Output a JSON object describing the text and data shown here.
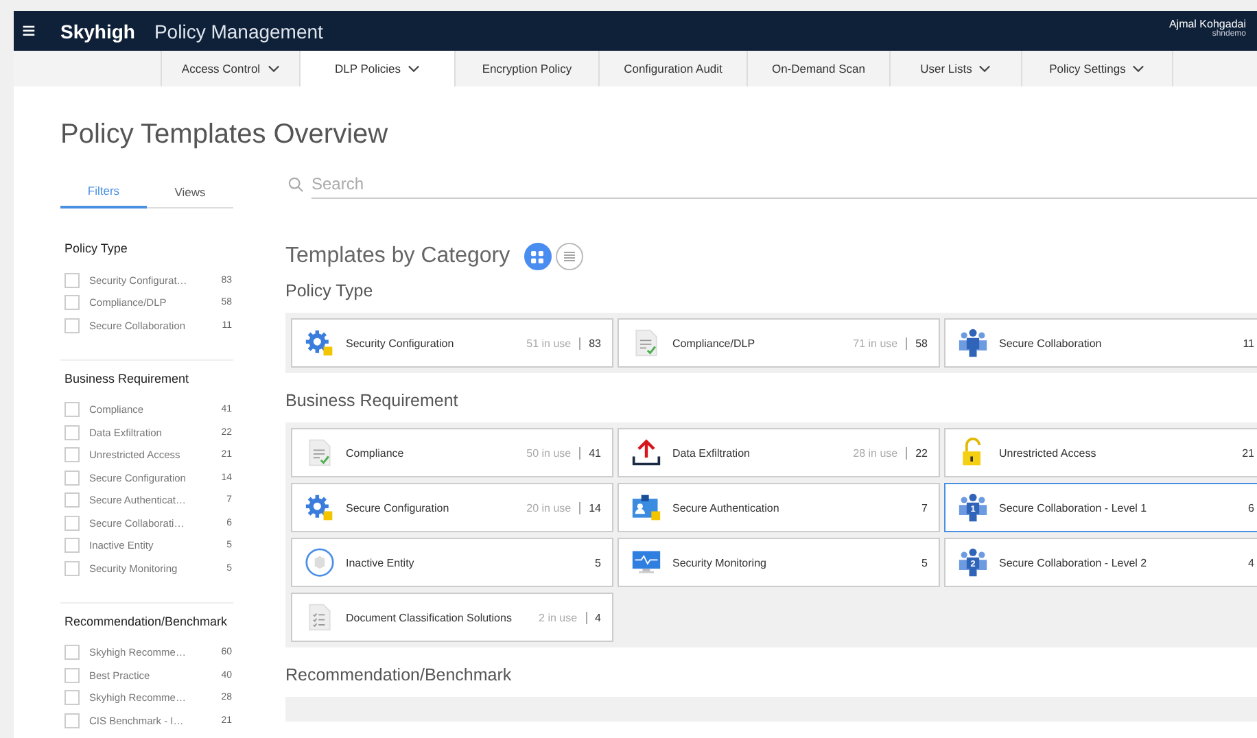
{
  "header": {
    "menu_icon": "≡",
    "brand": "Skyhigh",
    "app_title": "Policy Management",
    "user_name": "Ajmal Kohgadai",
    "tenant": "shndemo"
  },
  "nav_tabs": [
    {
      "label": "Access Control",
      "dropdown": true,
      "selected": false
    },
    {
      "label": "DLP Policies",
      "dropdown": true,
      "selected": true
    },
    {
      "label": "Encryption Policy",
      "dropdown": false,
      "selected": false
    },
    {
      "label": "Configuration Audit",
      "dropdown": false,
      "selected": false
    },
    {
      "label": "On-Demand Scan",
      "dropdown": false,
      "selected": false
    },
    {
      "label": "User Lists",
      "dropdown": true,
      "selected": false
    },
    {
      "label": "Policy Settings",
      "dropdown": true,
      "selected": false
    }
  ],
  "page_title": "Policy Templates Overview",
  "sidebar": {
    "tabs": [
      {
        "label": "Filters",
        "selected": true
      },
      {
        "label": "Views",
        "selected": false
      }
    ],
    "sections": [
      {
        "title": "Policy Type",
        "items": [
          {
            "label": "Security Configurat…",
            "count": "83",
            "checked": false
          },
          {
            "label": "Compliance/DLP",
            "count": "58",
            "checked": false
          },
          {
            "label": "Secure Collaboration",
            "count": "11",
            "checked": false
          }
        ]
      },
      {
        "title": "Business Requirement",
        "items": [
          {
            "label": "Compliance",
            "count": "41",
            "checked": false
          },
          {
            "label": "Data Exfiltration",
            "count": "22",
            "checked": false
          },
          {
            "label": "Unrestricted Access",
            "count": "21",
            "checked": false
          },
          {
            "label": "Secure Configuration",
            "count": "14",
            "checked": false
          },
          {
            "label": "Secure Authenticat…",
            "count": "7",
            "checked": false
          },
          {
            "label": "Secure Collaborati…",
            "count": "6",
            "checked": false
          },
          {
            "label": "Inactive Entity",
            "count": "5",
            "checked": false
          },
          {
            "label": "Security Monitoring",
            "count": "5",
            "checked": false
          }
        ]
      },
      {
        "title": "Recommendation/Benchmark",
        "items": [
          {
            "label": "Skyhigh Recomme…",
            "count": "60",
            "checked": false
          },
          {
            "label": "Best Practice",
            "count": "40",
            "checked": false
          },
          {
            "label": "Skyhigh Recomme…",
            "count": "28",
            "checked": false
          },
          {
            "label": "CIS Benchmark - I…",
            "count": "21",
            "checked": false
          }
        ]
      }
    ]
  },
  "search": {
    "placeholder": "Search"
  },
  "templates_heading": "Templates by Category",
  "view_toggle": [
    {
      "kind": "grid",
      "selected": true
    },
    {
      "kind": "list",
      "selected": false
    }
  ],
  "categories": [
    {
      "title": "Policy Type",
      "cards": [
        {
          "kind": "gear",
          "name": "Security Configuration",
          "in_use": "51 in use",
          "count": "83",
          "selected": false
        },
        {
          "kind": "doc-check",
          "name": "Compliance/DLP",
          "in_use": "71 in use",
          "count": "58",
          "selected": false
        },
        {
          "kind": "people",
          "name": "Secure Collaboration",
          "count": "11",
          "selected": false
        }
      ]
    },
    {
      "title": "Business Requirement",
      "cards": [
        {
          "kind": "doc-check",
          "name": "Compliance",
          "in_use": "50 in use",
          "count": "41",
          "selected": false
        },
        {
          "kind": "upload",
          "name": "Data Exfiltration",
          "in_use": "28 in use",
          "count": "22",
          "selected": false
        },
        {
          "kind": "lock",
          "name": "Unrestricted Access",
          "count": "21",
          "selected": false
        },
        {
          "kind": "gear",
          "name": "Secure Configuration",
          "in_use": "20 in use",
          "count": "14",
          "selected": false
        },
        {
          "kind": "id-card",
          "name": "Secure Authentication",
          "count": "7",
          "selected": false
        },
        {
          "kind": "people",
          "icon_number": "1",
          "name": "Secure Collaboration - Level 1",
          "count": "6",
          "selected": true
        },
        {
          "kind": "cube",
          "name": "Inactive Entity",
          "count": "5",
          "selected": false
        },
        {
          "kind": "monitor",
          "name": "Security Monitoring",
          "count": "5",
          "selected": false
        },
        {
          "kind": "people",
          "icon_number": "2",
          "name": "Secure Collaboration - Level 2",
          "count": "4",
          "selected": false
        },
        {
          "kind": "doc-list",
          "name": "Document Classification Solutions",
          "in_use": "2 in use",
          "count": "4",
          "selected": false
        }
      ]
    },
    {
      "title": "Recommendation/Benchmark"
    }
  ]
}
